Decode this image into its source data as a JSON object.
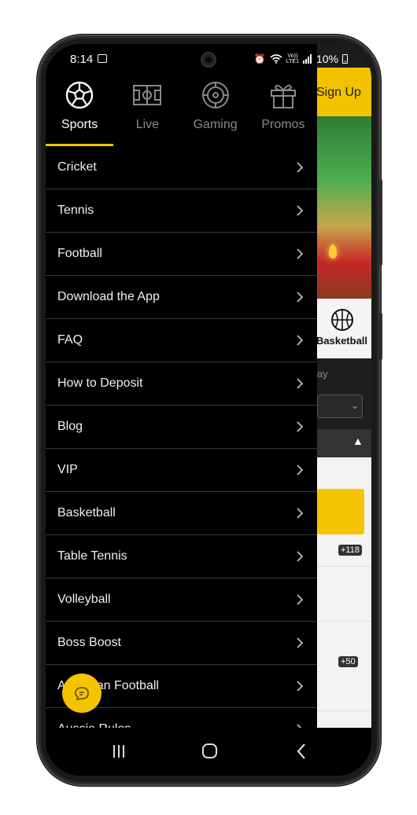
{
  "status_bar": {
    "time": "8:14",
    "battery": "10%",
    "volte": "Vo))\nLTE1"
  },
  "background_app": {
    "sign_up": "Sign Up",
    "sport_label": "Basketball",
    "day_text": "ay",
    "badges": [
      "+118",
      "+50"
    ]
  },
  "drawer": {
    "tabs": [
      {
        "label": "Sports",
        "icon": "soccer-ball-icon",
        "active": true
      },
      {
        "label": "Live",
        "icon": "field-icon",
        "active": false
      },
      {
        "label": "Gaming",
        "icon": "roulette-icon",
        "active": false
      },
      {
        "label": "Promos",
        "icon": "gift-icon",
        "active": false
      }
    ],
    "menu_items": [
      {
        "label": "Cricket"
      },
      {
        "label": "Tennis"
      },
      {
        "label": "Football"
      },
      {
        "label": "Download the App"
      },
      {
        "label": "FAQ"
      },
      {
        "label": "How to Deposit"
      },
      {
        "label": "Blog"
      },
      {
        "label": "VIP"
      },
      {
        "label": "Basketball"
      },
      {
        "label": "Table Tennis"
      },
      {
        "label": "Volleyball"
      },
      {
        "label": "Boss Boost"
      },
      {
        "label": "American Football"
      },
      {
        "label": "Aussie Rules"
      }
    ]
  },
  "colors": {
    "accent": "#f5c400",
    "drawer_bg": "#000000",
    "divider": "#3a3a3a",
    "inactive_tab": "#8a8a8a"
  }
}
